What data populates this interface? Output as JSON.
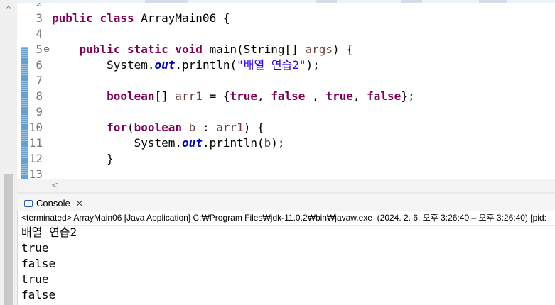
{
  "editor": {
    "lines": [
      {
        "num": "2",
        "code": ""
      },
      {
        "num": "3",
        "tokens": [
          [
            "kw",
            "public "
          ],
          [
            "kw",
            "class "
          ],
          [
            "",
            "ArrayMain06 {"
          ]
        ]
      },
      {
        "num": "4",
        "code": ""
      },
      {
        "num": "5",
        "tokens": [
          [
            "",
            "    "
          ],
          [
            "kw",
            "public "
          ],
          [
            "kw",
            "static "
          ],
          [
            "kw",
            "void "
          ],
          [
            "",
            "main(String[] "
          ],
          [
            "var",
            "args"
          ],
          [
            "",
            ") {"
          ]
        ]
      },
      {
        "num": "6",
        "tokens": [
          [
            "",
            "        System."
          ],
          [
            "fld",
            "out"
          ],
          [
            "",
            ".println("
          ],
          [
            "str",
            "\"배열 연습2\""
          ],
          [
            "",
            ");"
          ]
        ]
      },
      {
        "num": "7",
        "code": ""
      },
      {
        "num": "8",
        "tokens": [
          [
            "",
            "        "
          ],
          [
            "kw",
            "boolean"
          ],
          [
            "",
            "[] "
          ],
          [
            "var",
            "arr1"
          ],
          [
            "",
            " = {"
          ],
          [
            "kw",
            "true"
          ],
          [
            "",
            ", "
          ],
          [
            "kw",
            "false"
          ],
          [
            "",
            " , "
          ],
          [
            "kw",
            "true"
          ],
          [
            "",
            ", "
          ],
          [
            "kw",
            "false"
          ],
          [
            "",
            "};"
          ]
        ]
      },
      {
        "num": "9",
        "code": ""
      },
      {
        "num": "10",
        "tokens": [
          [
            "",
            "        "
          ],
          [
            "kw",
            "for"
          ],
          [
            "",
            "("
          ],
          [
            "kw",
            "boolean "
          ],
          [
            "var",
            "b"
          ],
          [
            "",
            " : "
          ],
          [
            "var",
            "arr1"
          ],
          [
            "",
            ") {"
          ]
        ]
      },
      {
        "num": "11",
        "tokens": [
          [
            "",
            "            System."
          ],
          [
            "fld",
            "out"
          ],
          [
            "",
            ".println("
          ],
          [
            "var",
            "b"
          ],
          [
            "",
            ");"
          ]
        ]
      },
      {
        "num": "12",
        "tokens": [
          [
            "",
            "        }"
          ]
        ]
      },
      {
        "num": "13",
        "code": ""
      }
    ]
  },
  "console": {
    "tab_label": "Console",
    "close_symbol": "✕",
    "status": "<terminated> ArrayMain06 [Java Application] C:₩Program Files₩jdk-11.0.2₩bin₩javaw.exe  (2024. 2. 6. 오후 3:26:40 – 오후 3:26:40) [pid:",
    "output": [
      "배열 연습2",
      "true",
      "false",
      "true",
      "false"
    ]
  },
  "colors": {
    "keyword": "#7f0055",
    "string": "#2a00ff",
    "field": "#0000c0",
    "variable": "#6a3e3e"
  }
}
